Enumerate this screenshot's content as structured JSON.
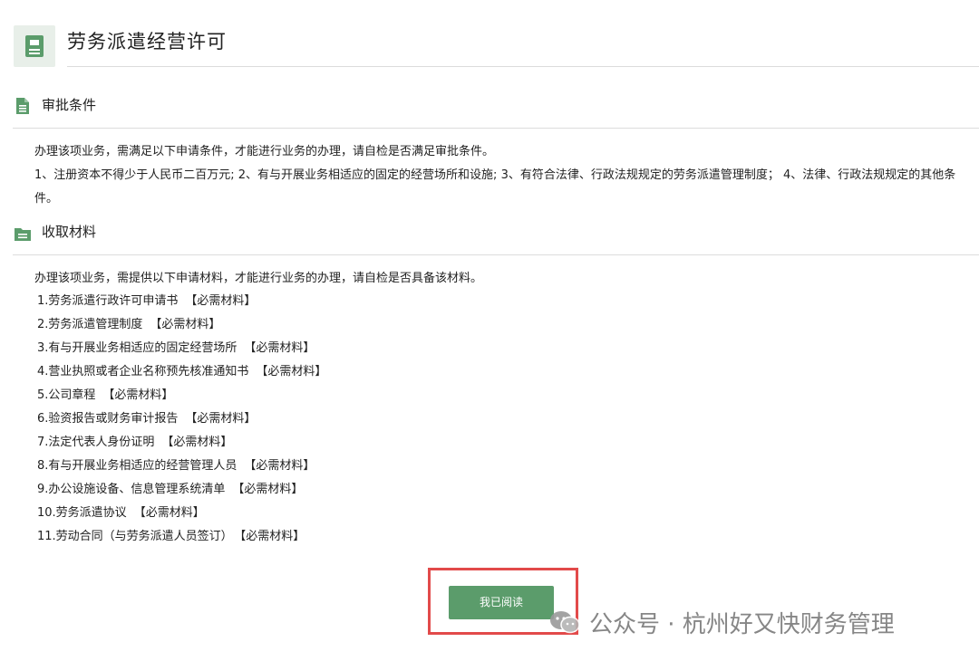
{
  "header": {
    "title": "劳务派遣经营许可",
    "icon": "document-icon"
  },
  "approval": {
    "title": "审批条件",
    "icon": "document-list-icon",
    "intro": "办理该项业务，需满足以下申请条件，才能进行业务的办理，请自检是否满足审批条件。",
    "conditions": "1、注册资本不得少于人民币二百万元; 2、有与开展业务相适应的固定的经营场所和设施; 3、有符合法律、行政法规规定的劳务派遣管理制度； 4、法律、行政法规规定的其他条件。"
  },
  "materials": {
    "title": "收取材料",
    "icon": "folder-icon",
    "intro": "办理该项业务，需提供以下申请材料，才能进行业务的办理，请自检是否具备该材料。",
    "items": [
      {
        "label": "1.劳务派遣行政许可申请书",
        "tag": "【必需材料】"
      },
      {
        "label": "2.劳务派遣管理制度",
        "tag": "【必需材料】"
      },
      {
        "label": "3.有与开展业务相适应的固定经营场所",
        "tag": "【必需材料】"
      },
      {
        "label": "4.营业执照或者企业名称预先核准通知书",
        "tag": "【必需材料】"
      },
      {
        "label": "5.公司章程",
        "tag": "【必需材料】"
      },
      {
        "label": "6.验资报告或财务审计报告",
        "tag": "【必需材料】"
      },
      {
        "label": "7.法定代表人身份证明",
        "tag": "【必需材料】"
      },
      {
        "label": "8.有与开展业务相适应的经营管理人员",
        "tag": "【必需材料】"
      },
      {
        "label": "9.办公设施设备、信息管理系统清单",
        "tag": "【必需材料】"
      },
      {
        "label": "10.劳务派遣协议",
        "tag": "【必需材料】"
      },
      {
        "label": "11.劳动合同（与劳务派遣人员签订）",
        "tag": "【必需材料】"
      }
    ]
  },
  "actions": {
    "read_label": "我已阅读"
  },
  "watermark": {
    "text": "公众号 · 杭州好又快财务管理"
  },
  "colors": {
    "accent": "#5b9c6b",
    "highlight": "#e24a4a"
  }
}
